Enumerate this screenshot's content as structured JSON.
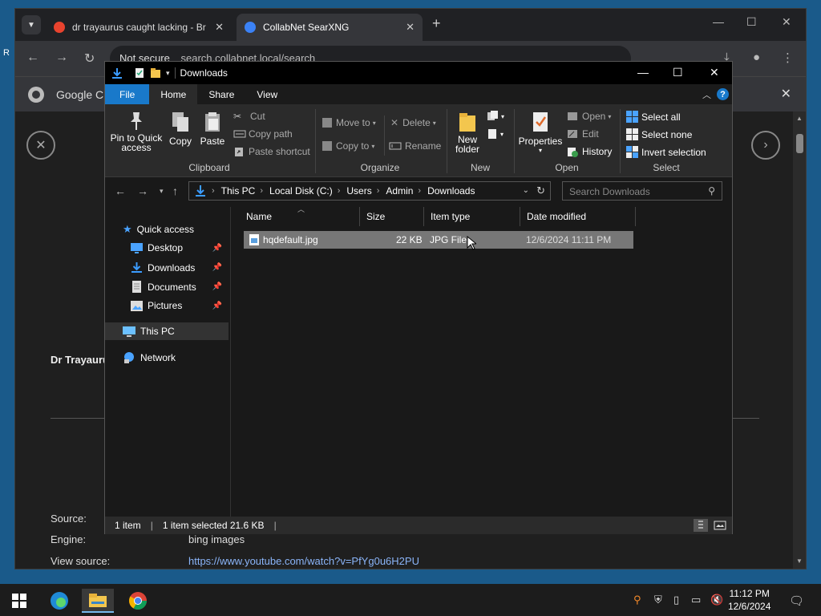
{
  "browser": {
    "tabs": [
      {
        "title": "dr trayaurus caught lacking - Br",
        "favicon_color": "#e8432e"
      },
      {
        "title": "CollabNet SearXNG",
        "favicon_color": "#3b82f6"
      }
    ],
    "url_security": "Not secure",
    "url": "search.collabnet.local/search",
    "infobar_text": "Google Ch"
  },
  "page": {
    "title": "Dr Trayaurus",
    "source_label": "Source:",
    "engine_label": "Engine:",
    "engine_value": "bing images",
    "view_source_label": "View source:",
    "view_source_url": "https://www.youtube.com/watch?v=PfYg0u6H2PU"
  },
  "explorer": {
    "title": "Downloads",
    "ribbon_tabs": [
      "File",
      "Home",
      "Share",
      "View"
    ],
    "clipboard": {
      "pin": "Pin to Quick access",
      "copy": "Copy",
      "paste": "Paste",
      "cut": "Cut",
      "copy_path": "Copy path",
      "paste_shortcut": "Paste shortcut",
      "label": "Clipboard"
    },
    "organize": {
      "move_to": "Move to",
      "copy_to": "Copy to",
      "delete": "Delete",
      "rename": "Rename",
      "label": "Organize"
    },
    "new": {
      "new_folder": "New folder",
      "label": "New"
    },
    "open": {
      "properties": "Properties",
      "open": "Open",
      "edit": "Edit",
      "history": "History",
      "label": "Open"
    },
    "select": {
      "select_all": "Select all",
      "select_none": "Select none",
      "invert": "Invert selection",
      "label": "Select"
    },
    "breadcrumbs": [
      "This PC",
      "Local Disk (C:)",
      "Users",
      "Admin",
      "Downloads"
    ],
    "search_placeholder": "Search Downloads",
    "nav": {
      "quick_access": "Quick access",
      "desktop": "Desktop",
      "downloads": "Downloads",
      "documents": "Documents",
      "pictures": "Pictures",
      "this_pc": "This PC",
      "network": "Network"
    },
    "columns": [
      "Name",
      "Size",
      "Item type",
      "Date modified"
    ],
    "files": [
      {
        "name": "hqdefault.jpg",
        "size": "22 KB",
        "type": "JPG File",
        "modified": "12/6/2024 11:11 PM"
      }
    ],
    "status": {
      "count": "1 item",
      "selected": "1 item selected  21.6 KB"
    }
  },
  "taskbar": {
    "time": "11:12 PM",
    "date": "12/6/2024"
  }
}
